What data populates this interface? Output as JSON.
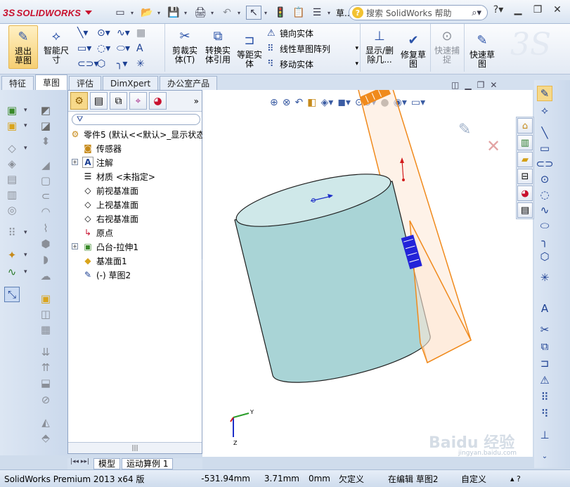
{
  "app": {
    "brand_prefix": "3S",
    "brand_name": "SOLIDWORKS"
  },
  "quick_access": {
    "truncated_label": "草..."
  },
  "search": {
    "placeholder": "搜索 SolidWorks 帮助"
  },
  "ribbon": {
    "exit_sketch": "退出草图",
    "smart_dimension": "智能尺寸",
    "trim": "剪裁实体(T)",
    "convert": "转换实体引用",
    "offset": "等距实体",
    "mirror": "镜向实体",
    "linear_pattern": "线性草图阵列",
    "move": "移动实体",
    "show_delete": "显示/删除几...",
    "repair": "修复草图",
    "quick_snaps": "快速捕捉",
    "rapid_sketch": "快速草图"
  },
  "tabs": [
    {
      "label": "特征"
    },
    {
      "label": "草图"
    },
    {
      "label": "评估"
    },
    {
      "label": "DimXpert"
    },
    {
      "label": "办公室产品"
    }
  ],
  "feature_tree": {
    "root": "零件5 (默认<<默认>_显示状态",
    "items": [
      {
        "label": "传感器"
      },
      {
        "label": "注解"
      },
      {
        "label": "材质 <未指定>"
      },
      {
        "label": "前视基准面"
      },
      {
        "label": "上视基准面"
      },
      {
        "label": "右视基准面"
      },
      {
        "label": "原点"
      },
      {
        "label": "凸台-拉伸1"
      },
      {
        "label": "基准面1"
      },
      {
        "label": "(-) 草图2"
      }
    ]
  },
  "bottom_tabs": [
    {
      "label": "模型"
    },
    {
      "label": "运动算例 1"
    }
  ],
  "triad": {
    "x": "X",
    "y": "Y",
    "z": "Z"
  },
  "watermark": {
    "text": "Baidu 经验",
    "url": "jingyan.baidu.com"
  },
  "status": {
    "product": "SolidWorks Premium 2013 x64 版",
    "x": "-531.94mm",
    "y": "3.71mm",
    "z": "0mm",
    "state": "欠定义",
    "editing": "在编辑 草图2",
    "custom": "自定义"
  },
  "colors": {
    "accent": "#c8102e",
    "body": "#a9d4d6",
    "plane": "#f08a1c"
  }
}
